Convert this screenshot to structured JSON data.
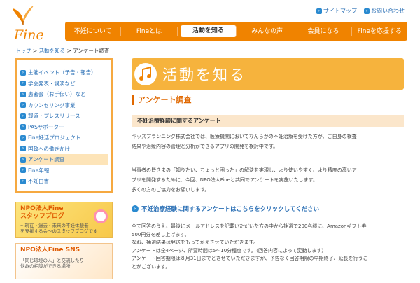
{
  "logo": {
    "text": "Fine"
  },
  "top_links": [
    {
      "label": "サイトマップ"
    },
    {
      "label": "お問い合わせ"
    }
  ],
  "global_nav": [
    {
      "label": "不妊について"
    },
    {
      "label": "Fineとは"
    },
    {
      "label": "活動を知る"
    },
    {
      "label": "みんなの声"
    },
    {
      "label": "会員になる"
    },
    {
      "label": "Fineを応援する"
    }
  ],
  "breadcrumb": {
    "home": "トップ",
    "parent": "活動を知る",
    "current": "アンケート調査",
    "sep": ">"
  },
  "sidebar": {
    "items": [
      {
        "label": "主催イベント（予告・報告）"
      },
      {
        "label": "学会発表・講演など"
      },
      {
        "label": "患者会（お手伝い）など"
      },
      {
        "label": "カウンセリング事業"
      },
      {
        "label": "報道・プレスリリース"
      },
      {
        "label": "PASサポーター"
      },
      {
        "label": "Fine妊活プロジェクト"
      },
      {
        "label": "国政への働きかけ"
      },
      {
        "label": "アンケート調査"
      },
      {
        "label": "Fine年報"
      },
      {
        "label": "不妊白書"
      }
    ]
  },
  "banners": {
    "staff_blog": {
      "title": "NPO法人Fine\nスタッフブログ",
      "sub": "～現在・過去・未来の不妊体験者\nを支援する会～のスタッフブログです"
    },
    "sns": {
      "title": "NPO法人Fine SNS",
      "sub": "「同じ環境の人」と交流したり\n悩みの相談ができる場所"
    }
  },
  "main": {
    "hero_title": "活動を知る",
    "section_title": "アンケート調査",
    "subsection_title": "不妊治療経験に関するアンケート",
    "para1": "キッズプランニング株式会社では、医療機関においてなんらかの不妊治療を受けた方が、ご自身の検査\n結果や治療内容の管理と分析ができるアプリの開発を検討中です。",
    "para2": "当事者の皆さまの「知りたい、ちょっと困った」の解決を実現し、より使いやすく、より精度の高いア\nプリを開発するために、今回、NPO法人Fineと共同でアンケートを実施いたします。\n多くの方のご協力をお願いします。",
    "cta_label": "不妊治療経験に関するアンケートはこちらをクリックしてください",
    "para3": "全て回答のうえ、最後にメールアドレスを記載いただいた方の中から抽選で200名様に、Amazonギフト券\n500円分を差し上げます。\nなお、抽選結果は発送をもってかえさせていただきます。\nアンケートは全4ページ、所要時間は5～10分程度です。（回答内容によって変動します）\nアンケート回答期限は８月31日までとさせていただきますが、予告なく回答期限の早期終了、延長を行うこ\nとがございます。"
  },
  "colors": {
    "accent": "#f08300",
    "link": "#2a6fb5",
    "hero_bg": "#f6b33d"
  }
}
